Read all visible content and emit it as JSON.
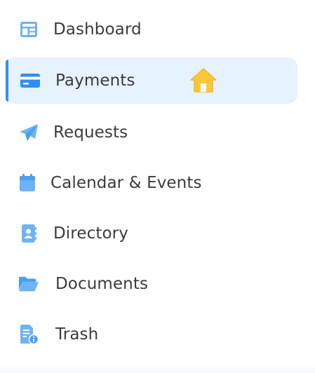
{
  "colors": {
    "icon": "#6db3f5",
    "active_bg": "#e6f2fd",
    "active_bar": "#2f8ff0",
    "label": "#3b3b3b",
    "home_icon": "#f8c83a"
  },
  "nav": {
    "items": [
      {
        "label": "Dashboard",
        "icon": "dashboard-icon"
      },
      {
        "label": "Payments",
        "icon": "credit-card-icon",
        "active": true,
        "badge_icon": "home-icon"
      },
      {
        "label": "Requests",
        "icon": "paper-plane-icon"
      },
      {
        "label": "Calendar & Events",
        "icon": "calendar-icon"
      },
      {
        "label": "Directory",
        "icon": "contact-book-icon"
      },
      {
        "label": "Documents",
        "icon": "folder-open-icon"
      },
      {
        "label": "Trash",
        "icon": "document-info-icon"
      }
    ]
  }
}
